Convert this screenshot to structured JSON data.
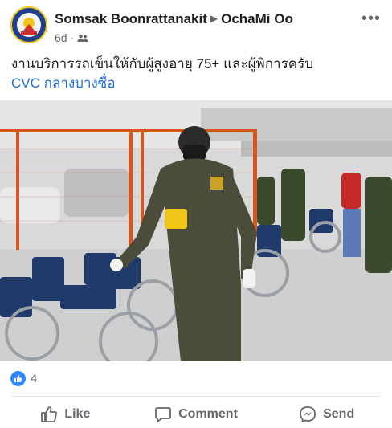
{
  "post": {
    "author": "Somsak Boonrattanakit",
    "group": "OchaMi Oo",
    "time": "6d",
    "text": "งานบริการรถเข็นให้กับผู้สูงอายุ 75+ และผู้พิการครับ",
    "link_text": "CVC กลางบางซื่อ"
  },
  "reactions": {
    "count": "4"
  },
  "actions": {
    "like": "Like",
    "comment": "Comment",
    "send": "Send"
  },
  "colors": {
    "accent": "#216fdb",
    "like_blue": "#2d88ff",
    "muted": "#65676b"
  }
}
